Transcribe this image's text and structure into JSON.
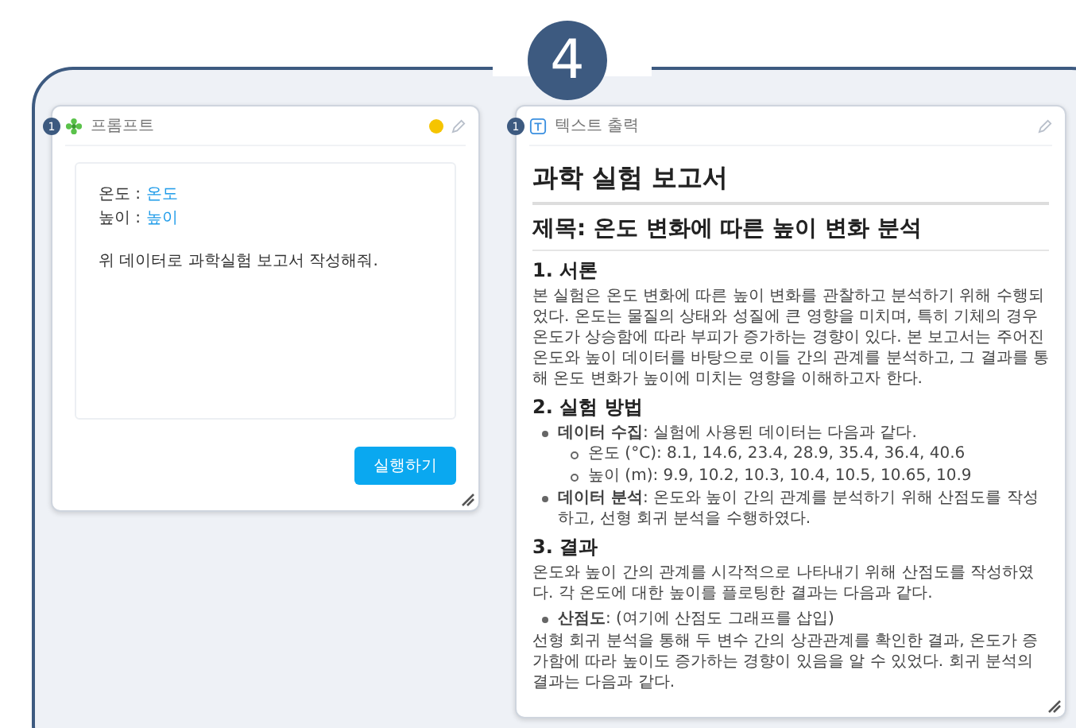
{
  "step_badge": "4",
  "prompt_node": {
    "port": "1",
    "title": "프롬프트",
    "variables": [
      {
        "label": "온도 :",
        "value": "온도"
      },
      {
        "label": "높이 :",
        "value": "높이"
      }
    ],
    "instruction": "위 데이터로 과학실험 보고서 작성해줘.",
    "run_button": "실행하기"
  },
  "output_node": {
    "port": "1",
    "title": "텍스트 출력",
    "blocks": [
      {
        "kind": "h1",
        "text": "과학 실험 보고서"
      },
      {
        "kind": "h2",
        "text": "제목: 온도 변화에 따른 높이 변화 분석"
      },
      {
        "kind": "h3",
        "text": "1. 서론"
      },
      {
        "kind": "p",
        "text": "본 실험은 온도 변화에 따른 높이 변화를 관찰하고 분석하기 위해 수행되었다. 온도는 물질의 상태와 성질에 큰 영향을 미치며, 특히 기체의 경우 온도가 상승함에 따라 부피가 증가하는 경향이 있다. 본 보고서는 주어진 온도와 높이 데이터를 바탕으로 이들 간의 관계를 분석하고, 그 결과를 통해 온도 변화가 높이에 미치는 영향을 이해하고자 한다."
      },
      {
        "kind": "h3",
        "text": "2. 실험 방법"
      },
      {
        "kind": "li",
        "text": "**데이터 수집**: 실험에 사용된 데이터는 다음과 같다.",
        "children": [
          {
            "kind": "li",
            "text": "온도 (°C): 8.1, 14.6, 23.4, 28.9, 35.4, 36.4, 40.6"
          },
          {
            "kind": "li",
            "text": "높이 (m): 9.9, 10.2, 10.3, 10.4, 10.5, 10.65, 10.9"
          }
        ]
      },
      {
        "kind": "li",
        "text": "**데이터 분석**: 온도와 높이 간의 관계를 분석하기 위해 산점도를 작성하고, 선형 회귀 분석을 수행하였다."
      },
      {
        "kind": "h3",
        "text": "3. 결과"
      },
      {
        "kind": "p",
        "text": "온도와 높이 간의 관계를 시각적으로 나타내기 위해 산점도를 작성하였다. 각 온도에 대한 높이를 플로팅한 결과는 다음과 같다."
      },
      {
        "kind": "li",
        "text": "**산점도**: (여기에 산점도 그래프를 삽입)"
      },
      {
        "kind": "p",
        "text": "선형 회귀 분석을 통해 두 변수 간의 상관관계를 확인한 결과, 온도가 증가함에 따라 높이도 증가하는 경향이 있음을 알 수 있었다. 회귀 분석의 결과는 다음과 같다."
      }
    ]
  }
}
